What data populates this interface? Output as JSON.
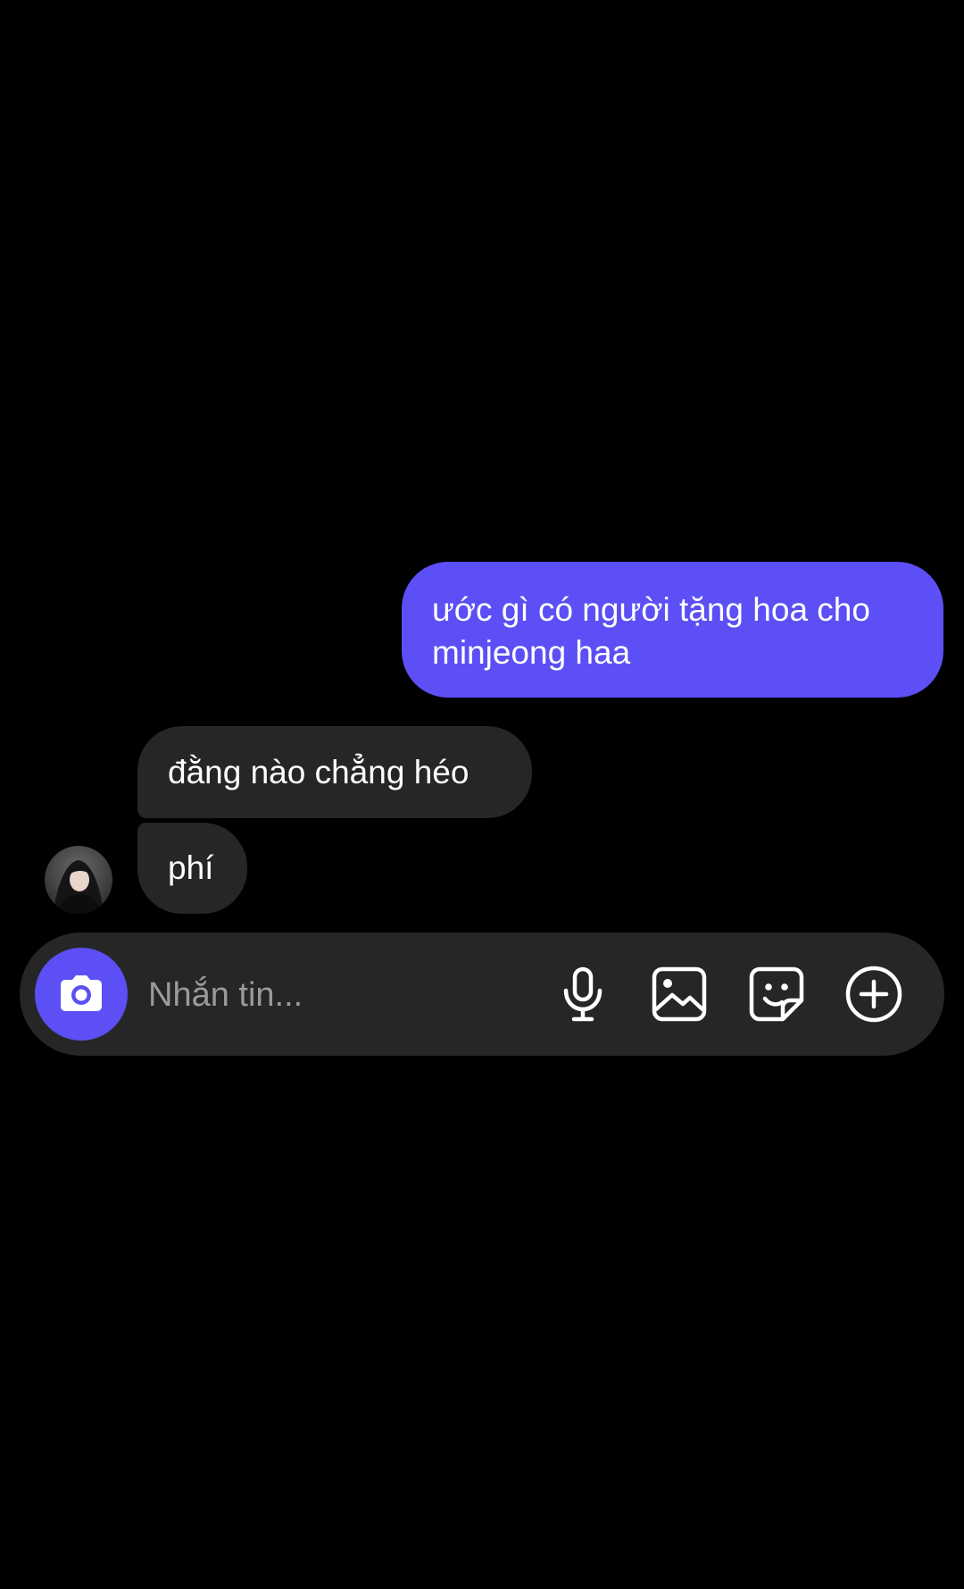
{
  "theme": {
    "background": "#000000",
    "outgoing_bubble": "#5b4ff5",
    "incoming_bubble": "#262626",
    "accent": "#5b4ff5",
    "placeholder": "#9a9a9a"
  },
  "conversation": {
    "messages": [
      {
        "direction": "outgoing",
        "text": "ước gì có người tặng hoa cho minjeong haa"
      },
      {
        "direction": "incoming",
        "text": "đằng nào chẳng héo"
      },
      {
        "direction": "incoming",
        "text": "phí"
      }
    ]
  },
  "composer": {
    "placeholder": "Nhắn tin...",
    "value": "",
    "icons": {
      "camera": "camera-icon",
      "mic": "microphone-icon",
      "gallery": "image-icon",
      "sticker": "sticker-icon",
      "more": "plus-circle-icon"
    }
  }
}
